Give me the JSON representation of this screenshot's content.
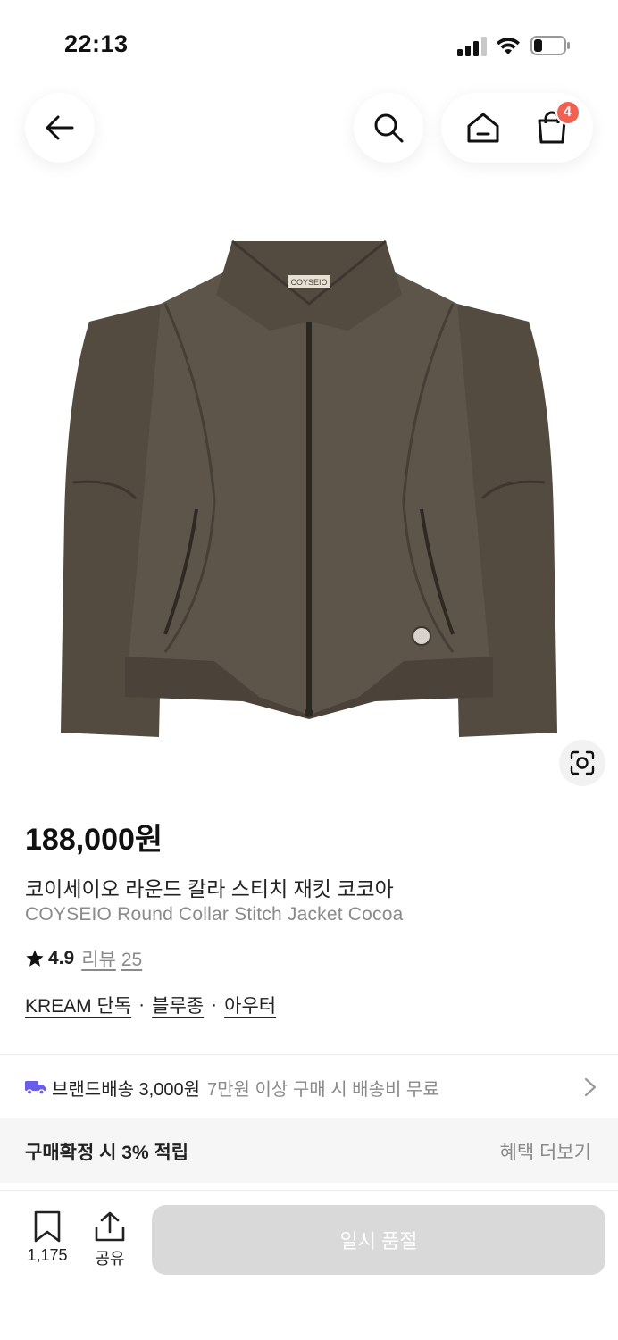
{
  "status_bar": {
    "time": "22:13"
  },
  "nav": {
    "cart_count": "4"
  },
  "product": {
    "brand_label": "COYSEIO",
    "price": "188,000원",
    "name_ko": "코이세이오 라운드 칼라 스티치 재킷 코코아",
    "name_en": "COYSEIO Round Collar Stitch Jacket Cocoa",
    "rating": "4.9",
    "review_label": "리뷰",
    "review_count": "25",
    "tags": [
      "KREAM 단독",
      "블루종",
      "아우터"
    ]
  },
  "shipping": {
    "main": "브랜드배송 3,000원",
    "sub": "7만원 이상 구매 시 배송비 무료"
  },
  "benefit": {
    "title": "구매확정 시 3% 적립",
    "link": "혜택 더보기"
  },
  "bottom_bar": {
    "bookmark_count": "1,175",
    "share_label": "공유",
    "main_button": "일시 품절"
  },
  "colors": {
    "badge": "#ef6253",
    "truck": "#6a5ee8",
    "jacket": "#5c5347",
    "disabled_button": "#d9d9d9"
  }
}
